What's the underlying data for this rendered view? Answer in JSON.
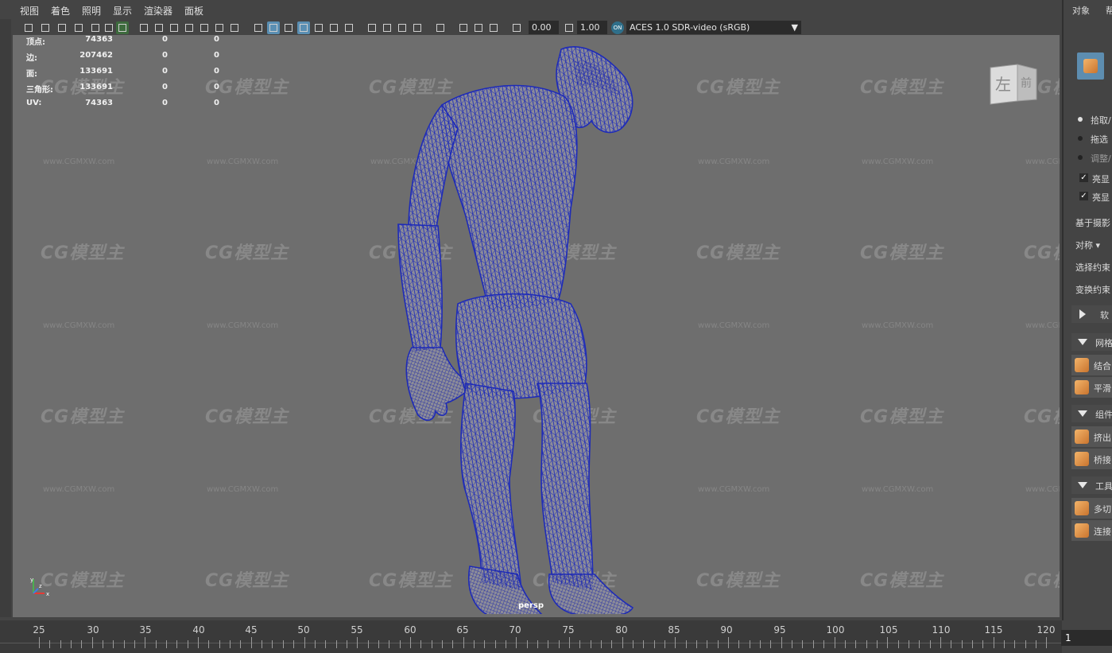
{
  "menu": {
    "items": [
      "视图",
      "着色",
      "照明",
      "显示",
      "渲染器",
      "面板"
    ]
  },
  "toolbar": {
    "exposure_value": "0.00",
    "gamma_value": "1.00",
    "colorspace_badge": "ON",
    "colorspace_value": "ACES 1.0 SDR-video (sRGB)"
  },
  "stats": {
    "rows": [
      {
        "label": "顶点:",
        "v1": "74363",
        "v2": "0",
        "v3": "0"
      },
      {
        "label": "边:",
        "v1": "207462",
        "v2": "0",
        "v3": "0"
      },
      {
        "label": "面:",
        "v1": "133691",
        "v2": "0",
        "v3": "0"
      },
      {
        "label": "三角形:",
        "v1": "133691",
        "v2": "0",
        "v3": "0"
      },
      {
        "label": "UV:",
        "v1": "74363",
        "v2": "0",
        "v3": "0"
      }
    ]
  },
  "viewport": {
    "camera_label": "persp",
    "viewcube": {
      "left_face": "左",
      "front_face": "前"
    },
    "watermark_logo": "CG模型主",
    "watermark_url": "www.CGMXW.com",
    "axis_labels": {
      "x": "x",
      "y": "y",
      "z": "z"
    }
  },
  "right_panel": {
    "tabs": [
      "对象",
      "帮"
    ],
    "pick_option": "拾取/",
    "drag_option": "拖选",
    "adjust_option": "调整/",
    "highlight1": "亮显",
    "highlight2": "亮显",
    "camera_based": "基于摄影",
    "symmetry": "对称 ▾",
    "select_constraint": "选择约束",
    "transform_constraint": "变换约束",
    "soft_section": "软",
    "mesh_section": "网格",
    "combine": "结合",
    "smooth": "平滑",
    "component_section": "组件",
    "extrude": "挤出",
    "bridge": "桥接",
    "tools_section": "工具",
    "multicut": "多切",
    "connect": "连接"
  },
  "timeline": {
    "labels": [
      "25",
      "30",
      "35",
      "40",
      "45",
      "50",
      "55",
      "60",
      "65",
      "70",
      "75",
      "80",
      "85",
      "90",
      "95",
      "100",
      "105",
      "110",
      "115",
      "120"
    ],
    "current_frame": "1"
  },
  "colors": {
    "viewport_bg": "#6e6e6e",
    "ui_bg": "#444444",
    "wireframe": "#1e2bb8",
    "accent_selected": "#5a8fb3"
  }
}
